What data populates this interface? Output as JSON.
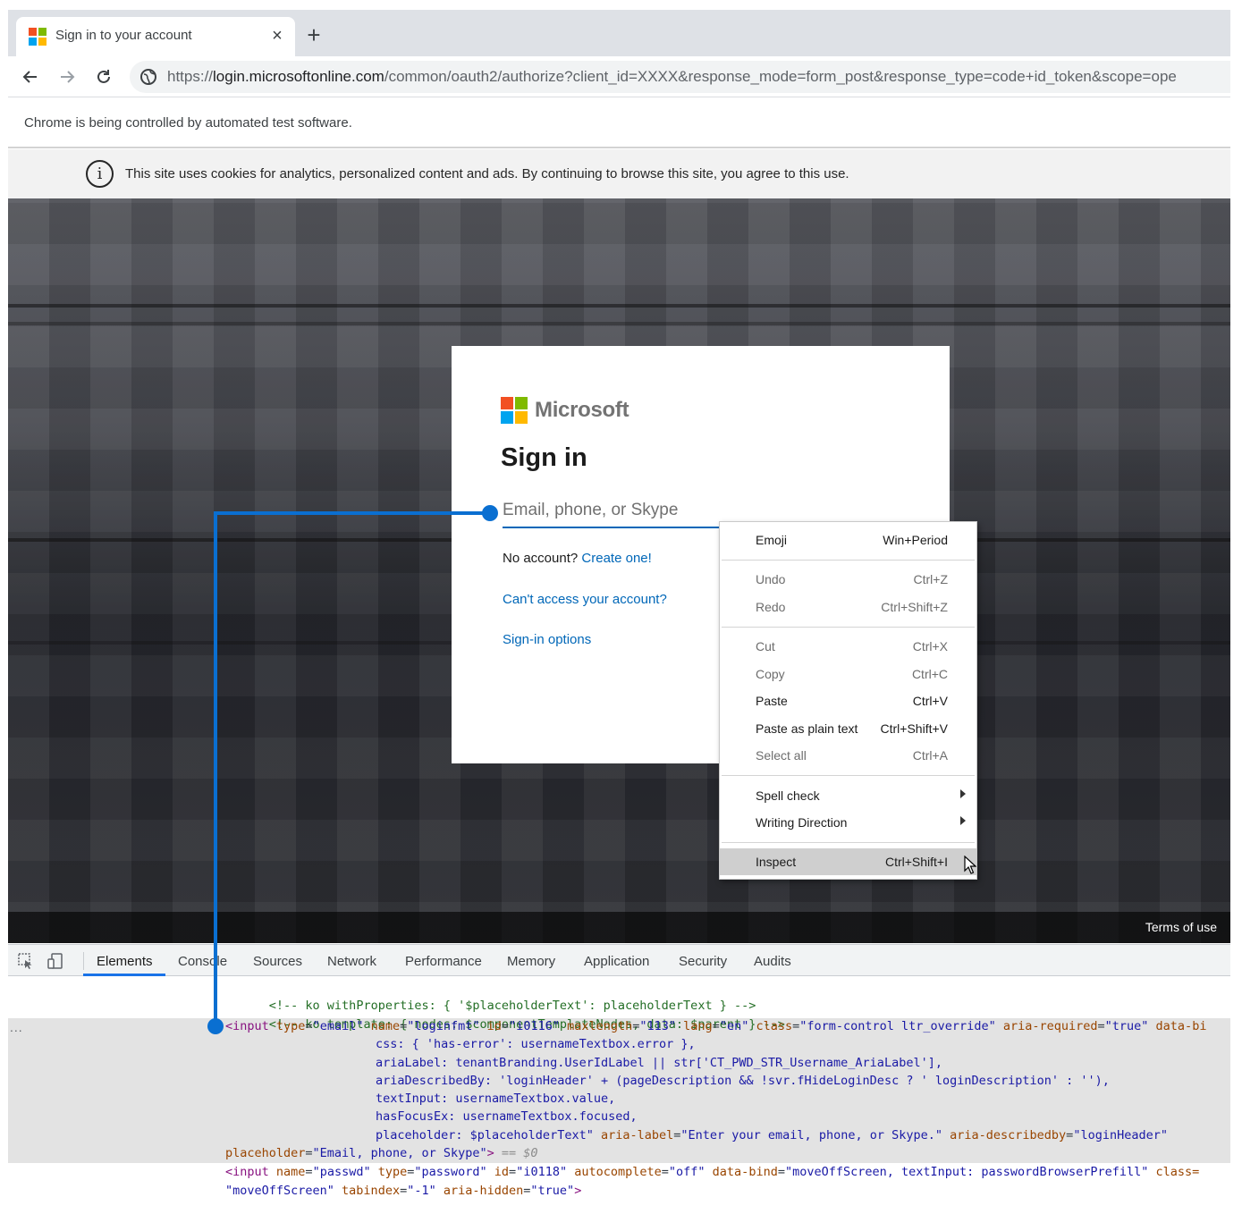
{
  "browser": {
    "tab_title": "Sign in to your account",
    "close_tab_glyph": "×",
    "new_tab_glyph": "+",
    "url": {
      "scheme": "https://",
      "host": "login.microsoftonline.com",
      "path": "/common/oauth2/authorize?client_id=XXXX&response_mode=form_post&response_type=code+id_token&scope=ope"
    },
    "automation_notice": "Chrome is being controlled by automated test software.",
    "icons": [
      "back-arrow-icon",
      "forward-arrow-icon",
      "reload-icon",
      "site-info-icon",
      "microsoft-favicon-icon"
    ]
  },
  "page": {
    "cookie_banner": {
      "icon_glyph": "i",
      "text": "This site uses cookies for analytics, personalized content and ads. By continuing to browse this site, you agree to this use."
    },
    "signin_card": {
      "brand": "Microsoft",
      "title": "Sign in",
      "email_placeholder": "Email, phone, or Skype",
      "no_account_text": "No account?",
      "create_link": "Create one!",
      "cant_access_link": "Can't access your account?",
      "signin_options_link": "Sign-in options"
    },
    "footer": {
      "terms": "Terms of use"
    }
  },
  "context_menu": {
    "items": [
      {
        "label": "Emoji",
        "shortcut": "Win+Period"
      },
      {
        "label": "Undo",
        "shortcut": "Ctrl+Z"
      },
      {
        "label": "Redo",
        "shortcut": "Ctrl+Shift+Z"
      },
      {
        "label": "Cut",
        "shortcut": "Ctrl+X"
      },
      {
        "label": "Copy",
        "shortcut": "Ctrl+C"
      },
      {
        "label": "Paste",
        "shortcut": "Ctrl+V"
      },
      {
        "label": "Paste as plain text",
        "shortcut": "Ctrl+Shift+V"
      },
      {
        "label": "Select all",
        "shortcut": "Ctrl+A"
      },
      {
        "label": "Spell check",
        "shortcut": ""
      },
      {
        "label": "Writing Direction",
        "shortcut": ""
      },
      {
        "label": "Inspect",
        "shortcut": "Ctrl+Shift+I"
      }
    ]
  },
  "devtools": {
    "tabs": [
      "Elements",
      "Console",
      "Sources",
      "Network",
      "Performance",
      "Memory",
      "Application",
      "Security",
      "Audits"
    ],
    "active_tab": "Elements",
    "ellipsis": "...",
    "code": {
      "l1": "<!-- ko withProperties: { '$placeholderText': placeholderText } -->",
      "l2": "<!-- ko template: { nodes: $componentTemplateNodes, data: $parent } -->",
      "l3": {
        "open": "<input",
        "a1": " type",
        "v1": "\"email\"",
        "a2": " name",
        "v2": "\"loginfmt\"",
        "a3": " id",
        "v3": "\"i0116\"",
        "a4": " maxlength",
        "v4": "\"113\"",
        "a5": " lang",
        "v5": "\"en\"",
        "a6": " class",
        "v6": "\"form-control ltr_override\"",
        "a7": " aria-required",
        "v7": "\"true\"",
        "a8": " data-bi"
      },
      "l4": "css: { 'has-error': usernameTextbox.error },",
      "l5": "ariaLabel: tenantBranding.UserIdLabel || str['CT_PWD_STR_Username_AriaLabel'],",
      "l6": "ariaDescribedBy: 'loginHeader' + (pageDescription && !svr.fHideLoginDesc ? ' loginDescription' : ''),",
      "l7": "textInput: usernameTextbox.value,",
      "l8": "hasFocusEx: usernameTextbox.focused,",
      "l9": {
        "text": "placeholder: $placeholderText\"",
        "a1": " aria-label",
        "v1": "\"Enter your email, phone, or Skype.\"",
        "a2": " aria-describedby",
        "v2": "\"loginHeader\""
      },
      "l10": {
        "a1": "placeholder",
        "v1": "\"Email, phone, or Skype\"",
        "close": ">",
        "eq": " == $0"
      },
      "l11": {
        "open": "<input",
        "a1": " name",
        "v1": "\"passwd\"",
        "a2": " type",
        "v2": "\"password\"",
        "a3": " id",
        "v3": "\"i0118\"",
        "a4": " autocomplete",
        "v4": "\"off\"",
        "a5": " data-bind",
        "v5": "\"moveOffScreen, textInput: passwordBrowserPrefill\"",
        "a6": " class="
      },
      "l12": {
        "v1": "\"moveOffScreen\"",
        "a2": " tabindex",
        "v2": "\"-1\"",
        "a3": " aria-hidden",
        "v3": "\"true\"",
        "close": ">"
      }
    }
  },
  "colors": {
    "accent_blue": "#0067b8",
    "annotation_blue": "#0a6fd1",
    "ms_red": "#f25022",
    "ms_green": "#7fba00",
    "ms_blue": "#00a4ef",
    "ms_yellow": "#ffb900"
  }
}
